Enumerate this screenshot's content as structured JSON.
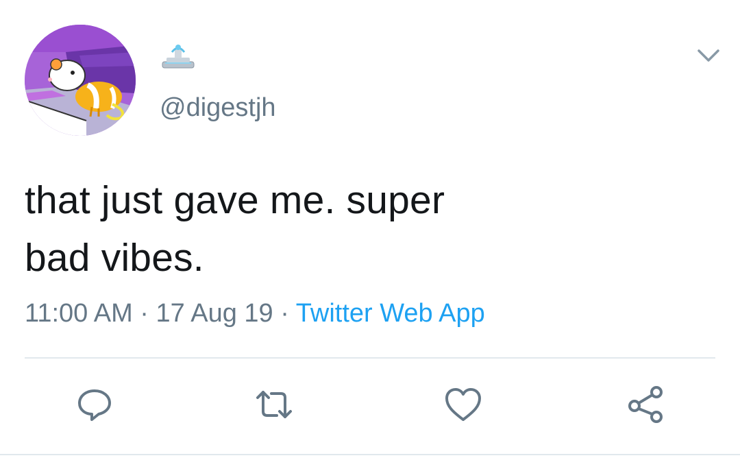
{
  "tweet": {
    "display_name_icon": "fountain-emoji",
    "handle": "@digestjh",
    "text_line1": "that just gave me. super",
    "text_line2": "bad vibes.",
    "time": "11:00 AM",
    "separator": " · ",
    "date": "17 Aug 19",
    "source": "Twitter Web App"
  },
  "actions": {
    "reply_icon": "reply-icon",
    "retweet_icon": "retweet-icon",
    "like_icon": "heart-icon",
    "share_icon": "share-icon"
  },
  "colors": {
    "text": "#14171a",
    "muted": "#657786",
    "link": "#1da1f2",
    "divider": "#e1e8ed"
  }
}
